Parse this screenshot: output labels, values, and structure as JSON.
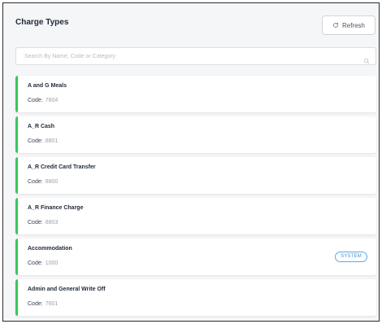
{
  "header": {
    "title": "Charge Types",
    "refresh_label": "Refresh",
    "refresh_icon": "refresh-icon"
  },
  "search": {
    "placeholder": "Search By Name, Code or Category",
    "value": "",
    "icon": "search-icon"
  },
  "code_label": "Code:",
  "accent_color": "#34c759",
  "charge_types": [
    {
      "name": "A and G Meals",
      "code": "7604",
      "badge": ""
    },
    {
      "name": "A_R Cash",
      "code": "8801",
      "badge": ""
    },
    {
      "name": "A_R Credit Card Transfer",
      "code": "8800",
      "badge": ""
    },
    {
      "name": "A_R Finance Charge",
      "code": "8803",
      "badge": ""
    },
    {
      "name": "Accommodation",
      "code": "1000",
      "badge": "SYSTEM"
    },
    {
      "name": "Admin and General Write Off",
      "code": "7601",
      "badge": ""
    }
  ]
}
